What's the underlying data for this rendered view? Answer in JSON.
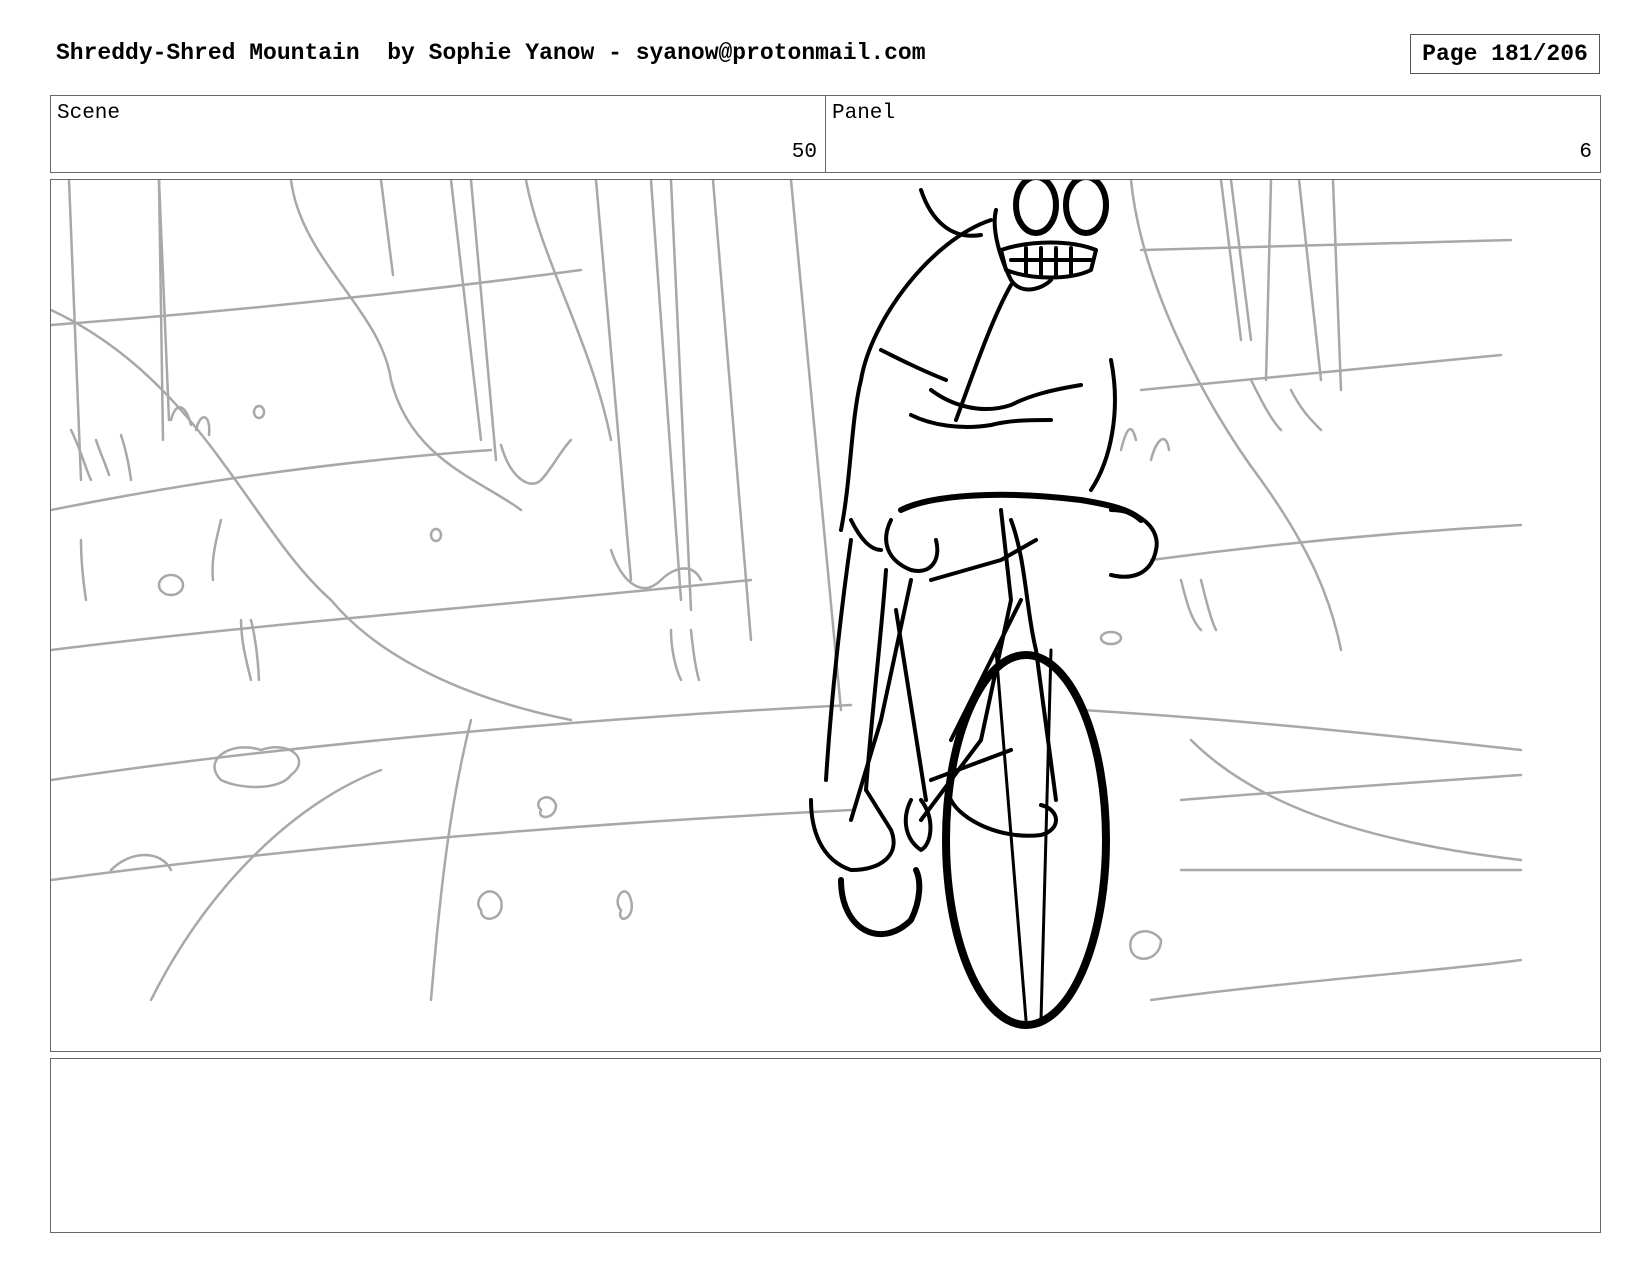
{
  "header": {
    "title": "Shreddy-Shred Mountain  by Sophie Yanow - syanow@protonmail.com",
    "page": "Page 181/206"
  },
  "info": {
    "scene_label": "Scene",
    "scene_value": "50",
    "panel_label": "Panel",
    "panel_value": "6"
  },
  "artwork": {
    "description_icon": "storyboard-sketch",
    "subject": "cyclist-riding-through-forest"
  },
  "notes": {
    "text": ""
  },
  "colors": {
    "border": "#666666",
    "sketch_light": "#a8a8a8",
    "sketch_dark": "#000000"
  }
}
